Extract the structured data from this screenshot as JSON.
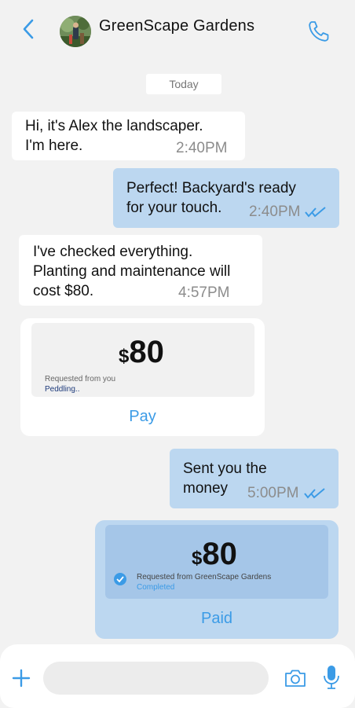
{
  "header": {
    "contact_name": "GreenScape Gardens",
    "back_icon": "chevron-left-icon",
    "call_icon": "phone-icon"
  },
  "date_divider": "Today",
  "messages": [
    {
      "direction": "incoming",
      "lines": [
        "Hi, it's Alex the landscaper.",
        "I'm here."
      ],
      "time": "2:40PM"
    },
    {
      "direction": "outgoing",
      "lines": [
        "Perfect! Backyard's ready",
        "for your touch."
      ],
      "time": "2:40PM",
      "read": true
    },
    {
      "direction": "incoming",
      "lines": [
        "I've checked everything.",
        "Planting and maintenance will",
        "cost $80."
      ],
      "time": "4:57PM"
    },
    {
      "direction": "outgoing",
      "lines": [
        "Sent you the",
        "money"
      ],
      "time": "5:00PM",
      "read": true
    }
  ],
  "payment_request": {
    "currency": "$",
    "amount": "80",
    "requested_text": "Requested from you",
    "status": "Peddling..",
    "action_label": "Pay"
  },
  "payment_sent": {
    "currency": "$",
    "amount": "80",
    "requested_text": "Requested from GreenScape Gardens",
    "status": "Completed",
    "action_label": "Paid"
  },
  "composer": {
    "placeholder": "",
    "icons": [
      "plus-icon",
      "camera-icon",
      "microphone-icon"
    ]
  },
  "colors": {
    "accent": "#3b9be6",
    "outgoing_bubble": "#bcd7f0",
    "incoming_bubble": "#ffffff",
    "background": "#f2f2f2"
  }
}
